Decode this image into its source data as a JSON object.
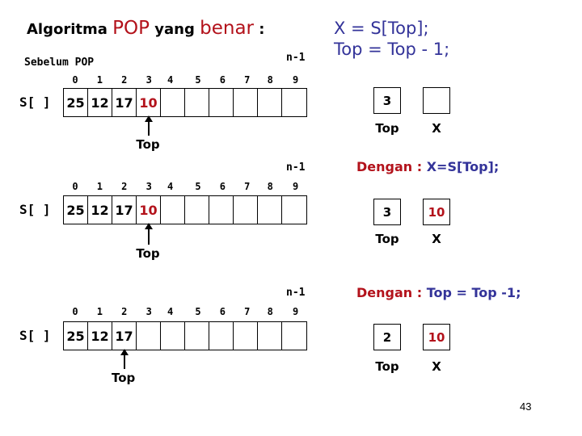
{
  "title": {
    "part1": "Algoritma ",
    "part2": "POP",
    "part3": " yang ",
    "part4": "benar",
    "part5": " :"
  },
  "subtitle": "Sebelum POP",
  "n_label": "n-1",
  "array_label": "S[ ]",
  "indices": [
    "0",
    "1",
    "2",
    "3",
    "4",
    "5",
    "6",
    "7",
    "8",
    "9"
  ],
  "code": {
    "line1": "X = S[Top];",
    "line2": "Top = Top - 1;"
  },
  "steps": [
    {
      "array": [
        "25",
        "12",
        "17",
        "10",
        "",
        "",
        "",
        "",
        "",
        ""
      ],
      "highlight_index": 3,
      "top_pointer_index": 3,
      "pointer_label": "Top",
      "caption_prefix": "",
      "caption_code": "",
      "top_value": "3",
      "x_value": "",
      "top_box_label": "Top",
      "x_box_label": "X"
    },
    {
      "array": [
        "25",
        "12",
        "17",
        "10",
        "",
        "",
        "",
        "",
        "",
        ""
      ],
      "highlight_index": 3,
      "top_pointer_index": 3,
      "pointer_label": "Top",
      "caption_prefix": "Dengan : ",
      "caption_code": "X=S[Top];",
      "top_value": "3",
      "x_value": "10",
      "top_box_label": "Top",
      "x_box_label": "X"
    },
    {
      "array": [
        "25",
        "12",
        "17",
        "",
        "",
        "",
        "",
        "",
        "",
        ""
      ],
      "highlight_index": -1,
      "top_pointer_index": 2,
      "pointer_label": "Top",
      "caption_prefix": "Dengan : ",
      "caption_code": "Top = Top -1;",
      "top_value": "2",
      "x_value": "10",
      "top_box_label": "Top",
      "x_box_label": "X"
    }
  ],
  "page_number": "43",
  "colors": {
    "accent_red": "#b3121b",
    "code_blue": "#333399"
  }
}
